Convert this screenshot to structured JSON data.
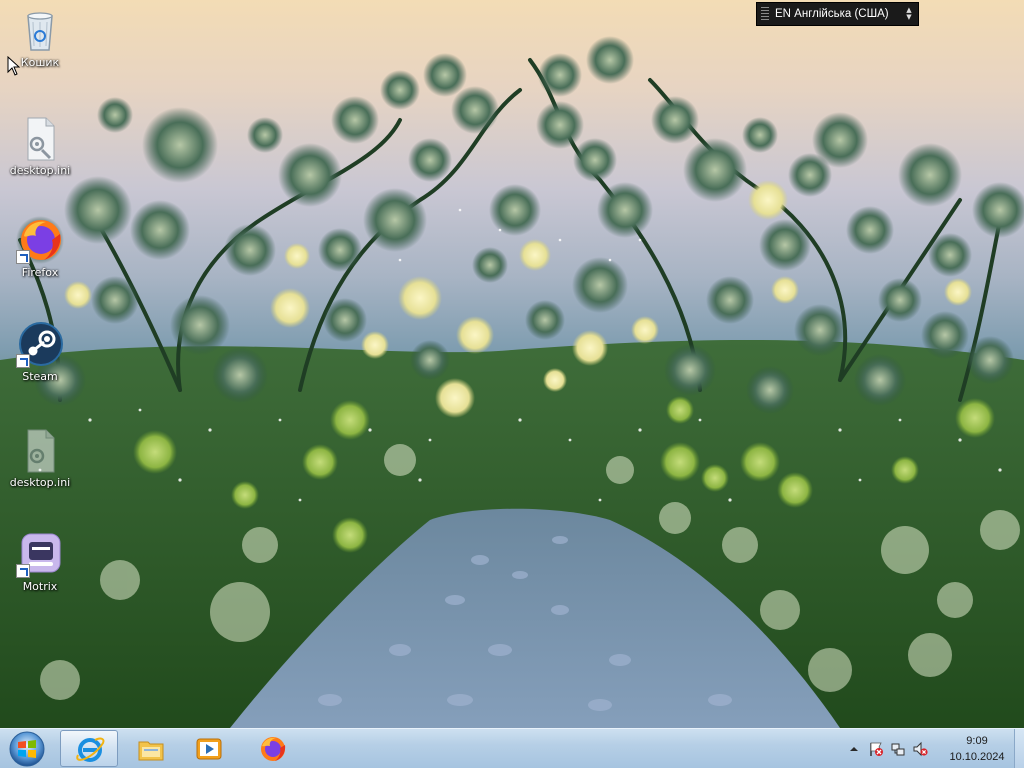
{
  "desktop": {
    "icons": [
      {
        "label": "Кошик",
        "icon": "recycle-bin-icon"
      },
      {
        "label": "desktop.ini",
        "icon": "settings-file-icon"
      },
      {
        "label": "Firefox",
        "icon": "firefox-icon"
      },
      {
        "label": "Steam",
        "icon": "steam-icon"
      },
      {
        "label": "desktop.ini",
        "icon": "settings-file-icon"
      },
      {
        "label": "Motrix",
        "icon": "motrix-icon"
      }
    ]
  },
  "language_bar": {
    "label": "EN Англійська (США)"
  },
  "taskbar": {
    "pinned": [
      {
        "icon": "internet-explorer-icon",
        "active": true
      },
      {
        "icon": "file-explorer-icon",
        "active": false
      },
      {
        "icon": "media-player-icon",
        "active": false
      },
      {
        "icon": "firefox-icon",
        "active": false
      }
    ],
    "tray": {
      "icons": [
        "show-hidden-icons-icon",
        "action-center-flag-icon",
        "network-icon",
        "volume-muted-icon"
      ],
      "time": "9:09",
      "date": "10.10.2024"
    }
  },
  "colors": {
    "taskbar_top": "#cde0f0",
    "taskbar_bottom": "#a6c4e0",
    "langbar_bg": "#1a1a1a"
  }
}
